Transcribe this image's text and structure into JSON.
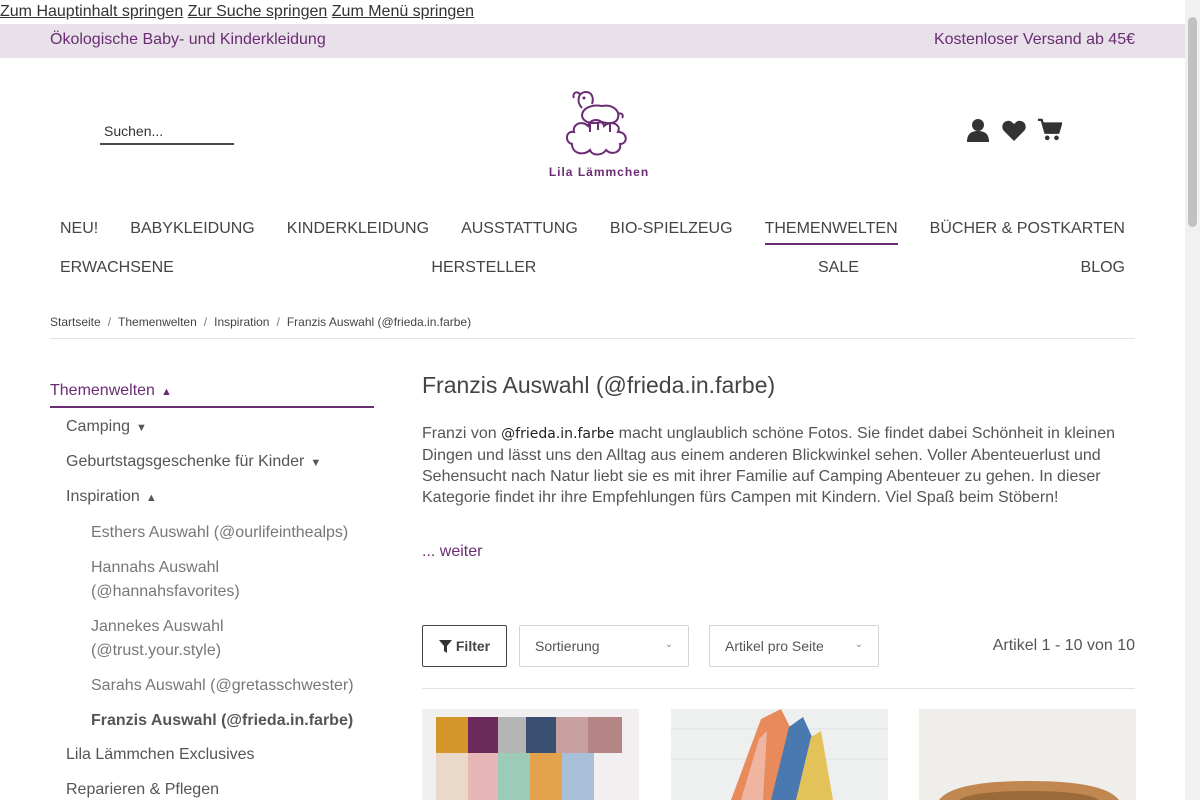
{
  "skip_links": [
    "Zum Hauptinhalt springen",
    "Zur Suche springen",
    "Zum Menü springen"
  ],
  "topbar": {
    "left": "Ökologische Baby- und Kinderkleidung",
    "right": "Kostenloser Versand ab 45€"
  },
  "search": {
    "placeholder": "Suchen..."
  },
  "logo": {
    "text": "Lila Lämmchen"
  },
  "header_icons": [
    "user-icon",
    "heart-icon",
    "cart-icon"
  ],
  "nav": {
    "row1": [
      {
        "label": "NEU!",
        "active": false
      },
      {
        "label": "BABYKLEIDUNG",
        "active": false
      },
      {
        "label": "KINDERKLEIDUNG",
        "active": false
      },
      {
        "label": "AUSSTATTUNG",
        "active": false
      },
      {
        "label": "BIO-SPIELZEUG",
        "active": false
      },
      {
        "label": "THEMENWELTEN",
        "active": true
      },
      {
        "label": "BÜCHER & POSTKARTEN",
        "active": false
      }
    ],
    "row2": [
      {
        "label": "ERWACHSENE"
      },
      {
        "label": "HERSTELLER"
      },
      {
        "label": "SALE"
      },
      {
        "label": "BLOG"
      }
    ]
  },
  "breadcrumb": [
    "Startseite",
    "Themenwelten",
    "Inspiration",
    "Franzis Auswahl (@frieda.in.farbe)"
  ],
  "sidebar": {
    "heading": "Themenwelten",
    "items": [
      {
        "label": "Camping"
      },
      {
        "label": "Geburtstagsgeschenke für Kinder"
      },
      {
        "label": "Inspiration"
      }
    ],
    "sub_items": [
      {
        "label": "Esthers Auswahl (@ourlifeinthealps)"
      },
      {
        "label": "Hannahs Auswahl (@hannahsfavorites)"
      },
      {
        "label": "Jannekes Auswahl (@trust.your.style)"
      },
      {
        "label": "Sarahs Auswahl (@gretasschwester)"
      },
      {
        "label": "Franzis Auswahl (@frieda.in.farbe)"
      }
    ],
    "bottom_items": [
      {
        "label": "Lila Lämmchen Exclusives"
      },
      {
        "label": "Reparieren & Pflegen"
      }
    ]
  },
  "content": {
    "title": "Franzis Auswahl (@frieda.in.farbe)",
    "desc_before": "Franzi von ",
    "desc_handle": "@frieda.in.farbe",
    "desc_after": " macht unglaublich schöne Fotos. Sie findet dabei Schönheit in kleinen Dingen und lässt uns den Alltag aus einem anderen Blickwinkel sehen. Voller Abenteuerlust und Sehensucht nach Natur liebt sie es mit ihrer Familie auf Camping Abenteuer zu gehen. In dieser Kategorie findet ihr ihre Empfehlungen fürs Campen mit Kindern. Viel Spaß beim Stöbern!",
    "more": "... weiter"
  },
  "toolbar": {
    "filter": "Filter",
    "sort": "Sortierung",
    "per_page": "Artikel pro Seite",
    "count": "Artikel 1 - 10 von 10"
  },
  "colors": {
    "brand": "#6a2c72",
    "topbar_bg": "#e8e1ea"
  }
}
